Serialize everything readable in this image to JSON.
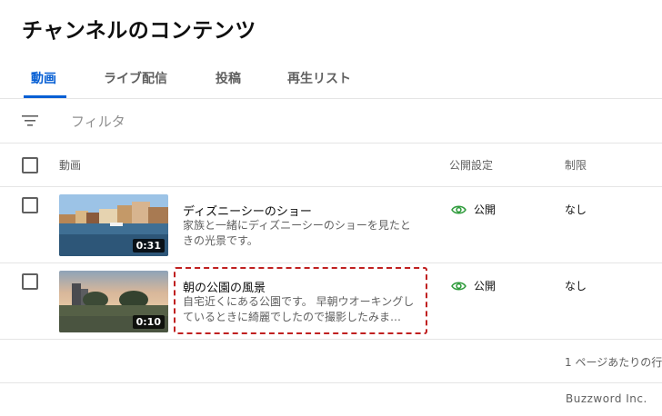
{
  "page": {
    "title": "チャンネルのコンテンツ"
  },
  "tabs": [
    {
      "label": "動画",
      "active": true
    },
    {
      "label": "ライブ配信",
      "active": false
    },
    {
      "label": "投稿",
      "active": false
    },
    {
      "label": "再生リスト",
      "active": false
    }
  ],
  "filter": {
    "placeholder": "フィルタ",
    "icon": "filter-icon"
  },
  "table": {
    "headers": {
      "video": "動画",
      "visibility": "公開設定",
      "restrictions": "制限"
    },
    "rows": [
      {
        "title": "ディズニーシーのショー",
        "description": "家族と一緒にディズニーシーのショーを見たときの光景です。",
        "duration": "0:31",
        "visibility": "公開",
        "restrictions": "なし"
      },
      {
        "title": "朝の公園の風景",
        "description": "自宅近くにある公園です。 早朝ウオーキングしているときに綺麗でしたので撮影したみま…",
        "duration": "0:10",
        "visibility": "公開",
        "restrictions": "なし"
      }
    ]
  },
  "pagination": {
    "rows_per_page_label": "1 ページあたりの行"
  },
  "watermark": "Buzzword Inc.",
  "colors": {
    "accent": "#065fd4",
    "public_icon": "#2e9b3b",
    "highlight": "#c02020"
  }
}
